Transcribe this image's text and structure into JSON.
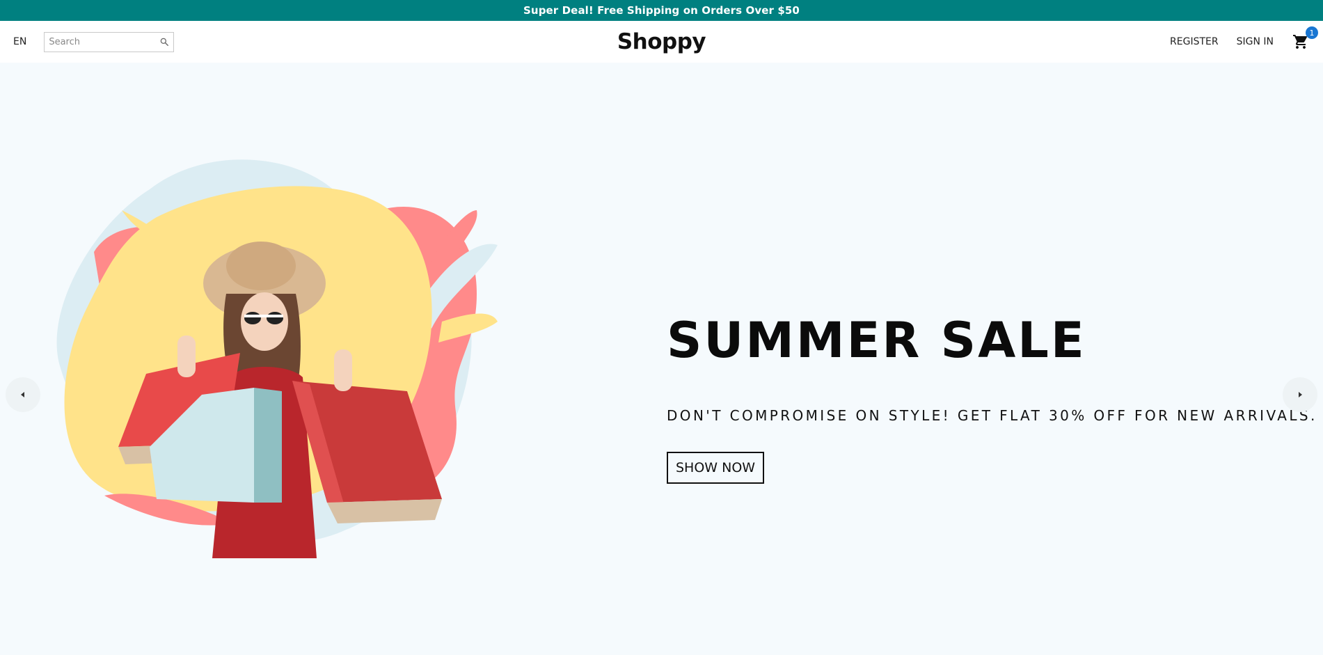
{
  "announcement": {
    "text": "Super Deal! Free Shipping on Orders Over $50"
  },
  "nav": {
    "language": "EN",
    "search_placeholder": "Search",
    "logo": "Shoppy",
    "register": "REGISTER",
    "sign_in": "SIGN IN",
    "cart_count": "1"
  },
  "hero": {
    "title": "SUMMER SALE",
    "description": "DON'T COMPROMISE ON STYLE! GET FLAT 30% OFF FOR NEW ARRIVALS.",
    "cta": "SHOW NOW"
  },
  "colors": {
    "announcement_bg": "#008080",
    "hero_bg": "#f5fafd",
    "badge": "#1976d2",
    "blob_yellow": "#ffe38a",
    "blob_pink": "#ff8a8a",
    "blob_blue": "#dcedf3",
    "bag_red": "#e84a4a"
  },
  "icons": [
    "search-icon",
    "cart-icon",
    "arrow-left-icon",
    "arrow-right-icon"
  ]
}
